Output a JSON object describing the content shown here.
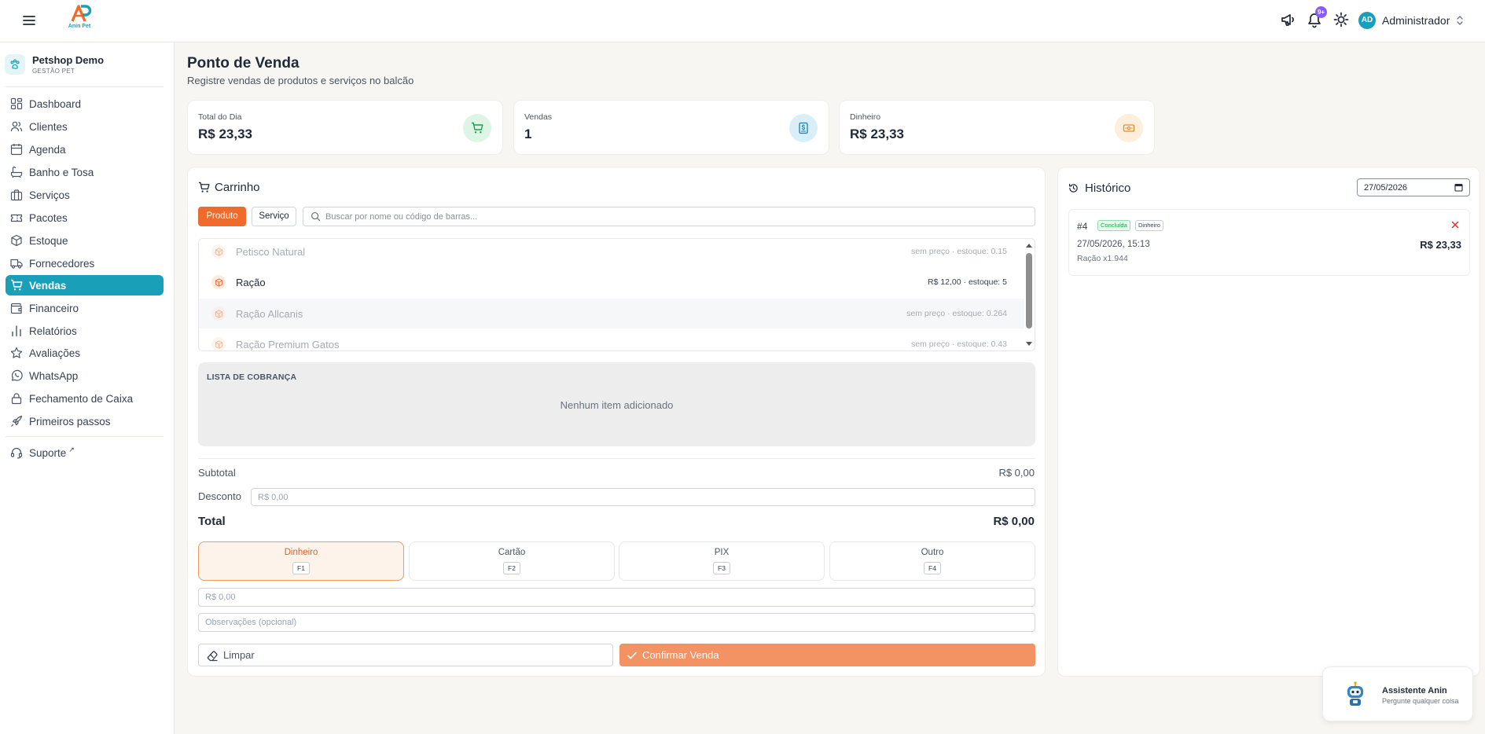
{
  "header": {
    "logo_text": "Anin Pet",
    "notification_count": "9+",
    "user_initials": "AD",
    "user_name": "Administrador"
  },
  "sidebar": {
    "shop_name": "Petshop Demo",
    "shop_subtitle": "GESTÃO PET",
    "items": [
      {
        "label": "Dashboard",
        "icon": "dashboard-icon"
      },
      {
        "label": "Clientes",
        "icon": "users-icon"
      },
      {
        "label": "Agenda",
        "icon": "calendar-icon"
      },
      {
        "label": "Banho e Tosa",
        "icon": "bath-icon"
      },
      {
        "label": "Serviços",
        "icon": "briefcase-icon"
      },
      {
        "label": "Pacotes",
        "icon": "ticket-icon"
      },
      {
        "label": "Estoque",
        "icon": "box-icon"
      },
      {
        "label": "Fornecedores",
        "icon": "truck-icon"
      },
      {
        "label": "Vendas",
        "icon": "cart-icon",
        "active": true
      },
      {
        "label": "Financeiro",
        "icon": "wallet-icon"
      },
      {
        "label": "Relatórios",
        "icon": "bar-chart-icon"
      },
      {
        "label": "Avaliações",
        "icon": "star-icon"
      },
      {
        "label": "WhatsApp",
        "icon": "whatsapp-icon"
      },
      {
        "label": "Fechamento de Caixa",
        "icon": "lock-icon"
      },
      {
        "label": "Primeiros passos",
        "icon": "rocket-icon"
      }
    ],
    "support_label": "Suporte",
    "support_ext": "↗"
  },
  "page": {
    "title": "Ponto de Venda",
    "subtitle": "Registre vendas de produtos e serviços no balcão"
  },
  "stats": [
    {
      "label": "Total do Dia",
      "value": "R$ 23,33",
      "color": "#16a34a"
    },
    {
      "label": "Vendas",
      "value": "1",
      "color": "#1a9fb8"
    },
    {
      "label": "Dinheiro",
      "value": "R$ 23,33",
      "color": "#ea8a2a"
    }
  ],
  "cart": {
    "title": "Carrinho",
    "tab_product": "Produto",
    "tab_service": "Serviço",
    "search_placeholder": "Buscar por nome ou código de barras...",
    "products": [
      {
        "name": "Petisco Natural",
        "info": "sem preço · estoque: 0.15"
      },
      {
        "name": "Ração",
        "info": "R$ 12,00 · estoque: 5"
      },
      {
        "name": "Ração Allcanis",
        "info": "sem preço · estoque: 0.264"
      },
      {
        "name": "Ração Premium Gatos",
        "info": "sem preço · estoque: 0.43"
      }
    ],
    "billing_title": "LISTA DE COBRANÇA",
    "billing_empty": "Nenhum item adicionado",
    "subtotal_label": "Subtotal",
    "subtotal_value": "R$ 0,00",
    "discount_label": "Desconto",
    "discount_placeholder": "R$ 0,00",
    "total_label": "Total",
    "total_value": "R$ 0,00",
    "payment_methods": [
      {
        "label": "Dinheiro",
        "key": "F1",
        "selected": true
      },
      {
        "label": "Cartão",
        "key": "F2"
      },
      {
        "label": "PIX",
        "key": "F3"
      },
      {
        "label": "Outro",
        "key": "F4"
      }
    ],
    "amount_placeholder": "R$ 0,00",
    "notes_placeholder": "Observações (opcional)",
    "clear_label": "Limpar",
    "confirm_label": "Confirmar Venda"
  },
  "history": {
    "title": "Histórico",
    "date": "27/05/2026",
    "sales": [
      {
        "number": "#4",
        "status": "Concluída",
        "payment": "Dinheiro",
        "datetime": "27/05/2026, 15:13",
        "total": "R$ 23,33",
        "items": "Ração x1.944"
      }
    ]
  },
  "assistant": {
    "title": "Assistente Anin",
    "subtitle": "Pergunte qualquer coisa"
  }
}
